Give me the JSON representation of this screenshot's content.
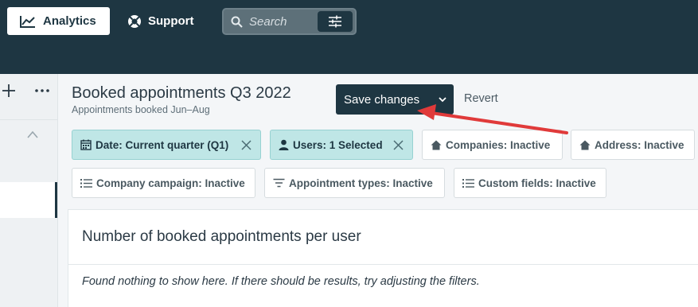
{
  "topbar": {
    "nav": [
      {
        "label": "Analytics",
        "icon": "line-chart-icon"
      },
      {
        "label": "Support",
        "icon": "lifebuoy-icon"
      }
    ],
    "search": {
      "placeholder": "Search",
      "icon": "search-icon",
      "filter_icon": "sliders-icon"
    }
  },
  "header": {
    "title": "Booked appointments Q3 2022",
    "subtitle": "Appointments booked Jun–Aug",
    "save_label": "Save changes",
    "revert_label": "Revert"
  },
  "filters": [
    {
      "label": "Date: Current quarter (Q1)",
      "icon": "calendar-icon",
      "active": true
    },
    {
      "label": "Users: 1 Selected",
      "icon": "user-icon",
      "active": true
    },
    {
      "label": "Companies: Inactive",
      "icon": "home-icon",
      "active": false
    },
    {
      "label": "Address: Inactive",
      "icon": "home-icon",
      "active": false
    },
    {
      "label": "Company campaign: Inactive",
      "icon": "list-icon",
      "active": false
    },
    {
      "label": "Appointment types: Inactive",
      "icon": "filter-icon",
      "active": false
    },
    {
      "label": "Custom fields: Inactive",
      "icon": "list-icon",
      "active": false
    }
  ],
  "panel": {
    "title": "Number of booked appointments per user",
    "empty_message": "Found nothing to show here. If there should be results, try adjusting the filters."
  },
  "colors": {
    "topbar": "#1e3642",
    "active_chip": "#bfe6e6",
    "annotation_arrow": "#e03a3a"
  }
}
